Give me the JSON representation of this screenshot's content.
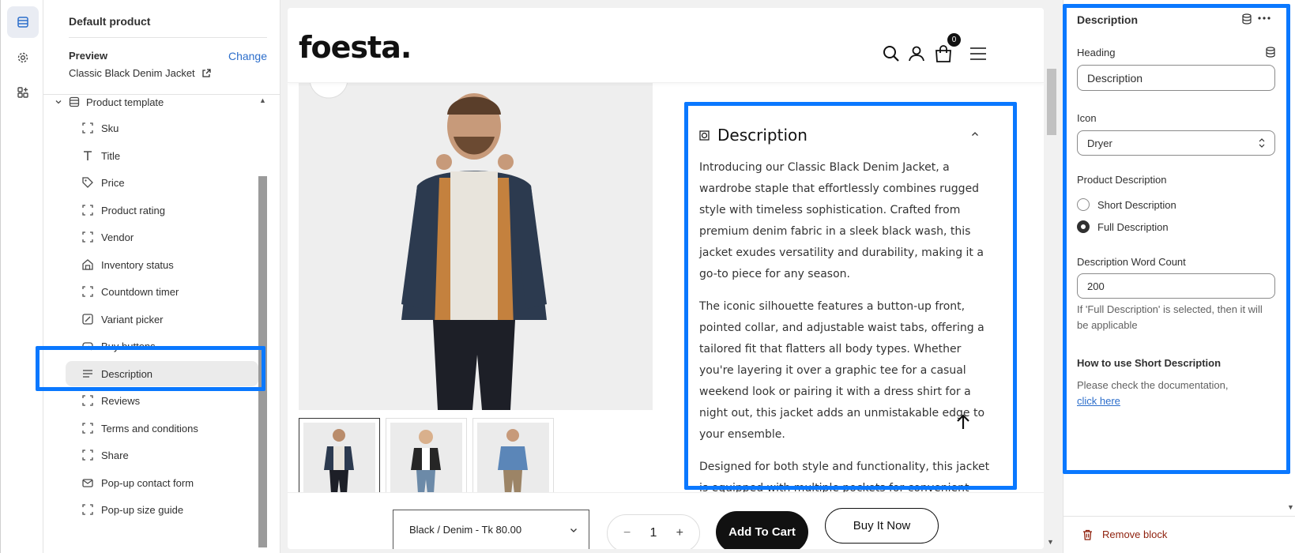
{
  "rail": {
    "items": [
      {
        "icon": "sections-icon",
        "active": true
      },
      {
        "icon": "settings-icon",
        "active": false
      },
      {
        "icon": "apps-icon",
        "active": false
      }
    ]
  },
  "left_panel": {
    "title": "Default product",
    "preview_label": "Preview",
    "change_label": "Change",
    "preview_product": "Classic Black Denim Jacket",
    "template_label": "Product template",
    "items": [
      {
        "label": "Sku",
        "icon": "block-icon"
      },
      {
        "label": "Title",
        "icon": "text-icon"
      },
      {
        "label": "Price",
        "icon": "price-tag-icon"
      },
      {
        "label": "Product rating",
        "icon": "block-icon"
      },
      {
        "label": "Vendor",
        "icon": "block-icon"
      },
      {
        "label": "Inventory status",
        "icon": "inventory-icon"
      },
      {
        "label": "Countdown timer",
        "icon": "block-icon"
      },
      {
        "label": "Variant picker",
        "icon": "variant-icon"
      },
      {
        "label": "Buy buttons",
        "icon": "buy-button-icon"
      },
      {
        "label": "Description",
        "icon": "paragraph-icon",
        "selected": true
      },
      {
        "label": "Reviews",
        "icon": "block-icon"
      },
      {
        "label": "Terms and conditions",
        "icon": "block-icon"
      },
      {
        "label": "Share",
        "icon": "block-icon"
      },
      {
        "label": "Pop-up contact form",
        "icon": "mail-icon"
      },
      {
        "label": "Pop-up size guide",
        "icon": "block-icon"
      }
    ]
  },
  "store": {
    "logo": "foesta.",
    "cart_count": "0",
    "description_heading": "Description",
    "description_paragraphs": [
      "Introducing our Classic Black Denim Jacket, a wardrobe staple that effortlessly combines rugged style with timeless sophistication. Crafted from premium denim fabric in a sleek black wash, this jacket exudes versatility and durability, making it a go-to piece for any season.",
      "The iconic silhouette features a button-up front, pointed collar, and adjustable waist tabs, offering a tailored fit that flatters all body types. Whether you're layering it over a graphic tee for a casual weekend look or pairing it with a dress shirt for a night out, this jacket adds an unmistakable edge to your ensemble.",
      "Designed for both style and functionality, this jacket is equipped with multiple pockets for convenient storage and buttoned cuffs for adjustable comfort. The durable denim construction ensures long-lasting wear, while the timeless"
    ],
    "variant_value": "Black / Denim - Tk 80.00",
    "quantity": "1",
    "minus": "−",
    "plus": "+",
    "add_to_cart": "Add To Cart",
    "buy_now": "Buy It Now"
  },
  "right_panel": {
    "title": "Description",
    "heading_label": "Heading",
    "heading_value": "Description",
    "icon_label": "Icon",
    "icon_value": "Dryer",
    "product_description_label": "Product Description",
    "radio_short": "Short Description",
    "radio_full": "Full Description",
    "word_count_label": "Description Word Count",
    "word_count_value": "200",
    "word_count_help": "If 'Full Description' is selected, then it will be applicable",
    "howto_heading": "How to use Short Description",
    "howto_text": "Please check the documentation,",
    "howto_link": "click here",
    "remove_label": "Remove block"
  },
  "colors": {
    "highlight": "#0a78ff",
    "link": "#2c6ecb",
    "danger": "#8e1f0b"
  }
}
